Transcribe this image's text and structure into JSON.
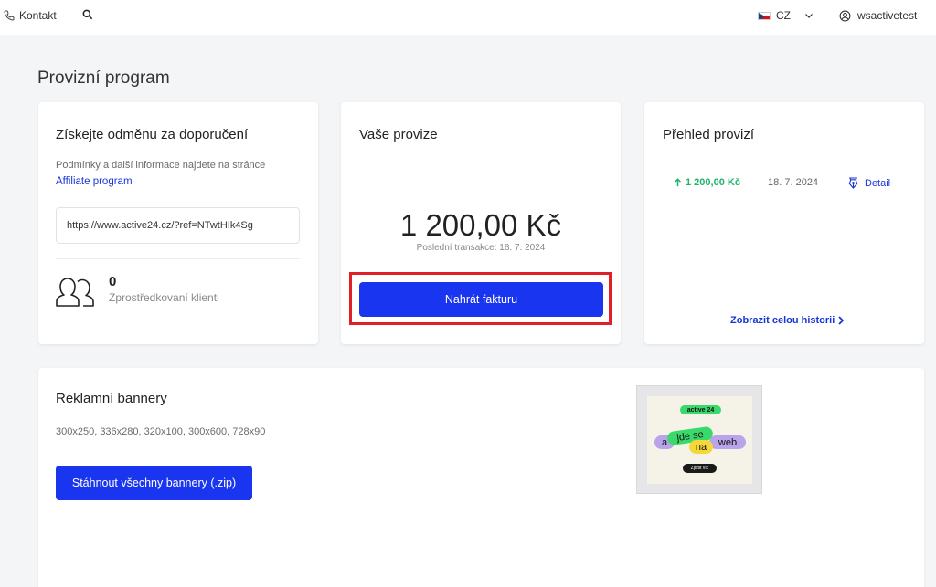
{
  "topbar": {
    "contact_label": "Kontakt",
    "language": "CZ",
    "username": "wsactivetest"
  },
  "page": {
    "title": "Provizní program"
  },
  "referral": {
    "title": "Získejte odměnu za doporučení",
    "info_text": "Podmínky a další informace najdete na stránce",
    "link_label": "Affiliate program",
    "ref_url": "https://www.active24.cz/?ref=NTwtHIk4Sg",
    "clients_count": "0",
    "clients_label": "Zprostředkovaní klienti"
  },
  "commission": {
    "title": "Vaše provize",
    "amount": "1 200,00 Kč",
    "last_transaction": "Poslední transakce: 18. 7. 2024",
    "upload_button": "Nahrát fakturu"
  },
  "overview": {
    "title": "Přehled provizí",
    "rows": [
      {
        "amount": "1 200,00 Kč",
        "date": "18. 7. 2024",
        "detail_label": "Detail"
      }
    ],
    "history_link": "Zobrazit celou historii"
  },
  "banners": {
    "title": "Reklamní bannery",
    "sizes": "300x250, 336x280, 320x100, 300x600, 728x90",
    "download_button": "Stáhnout všechny bannery (.zip)",
    "preview": {
      "logo": "active 24",
      "word_a": "a",
      "word_jde_se": "jde se",
      "word_na": "na",
      "word_web": "web",
      "cta": "Zjistit víc"
    }
  },
  "colors": {
    "primary": "#1a35f0",
    "link": "#1a35d6",
    "positive": "#1db36b",
    "highlight": "#e01f26"
  }
}
